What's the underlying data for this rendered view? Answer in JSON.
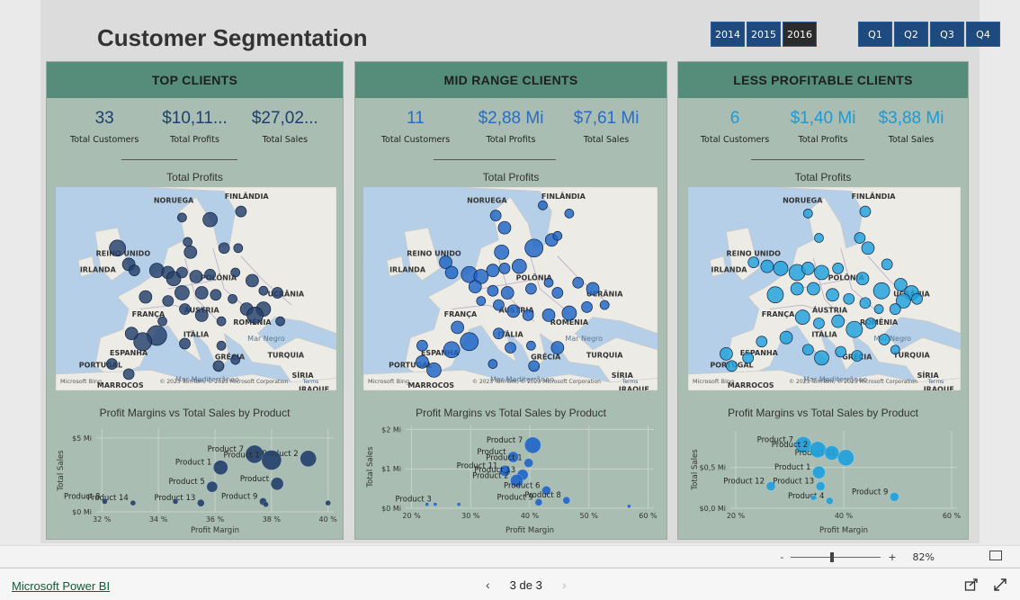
{
  "page_title": "Customer Segmentation",
  "years": [
    "2014",
    "2015",
    "2016"
  ],
  "selected_year": "2016",
  "quarters": [
    "Q1",
    "Q2",
    "Q3",
    "Q4"
  ],
  "panels": [
    {
      "id": "top",
      "header": "TOP CLIENTS",
      "kpis": [
        {
          "value": "33",
          "label": "Total Customers"
        },
        {
          "value": "$10,11...",
          "label": "Total Profits"
        },
        {
          "value": "$27,02...",
          "label": "Total Sales"
        }
      ],
      "kpi_color": "#1e3f70",
      "map_title": "Total Profits",
      "bubble_color": "#243f6b",
      "scatter_title": "Profit Margins vs Total Sales by Product"
    },
    {
      "id": "mid",
      "header": "MID RANGE CLIENTS",
      "kpis": [
        {
          "value": "11",
          "label": "Total Customers"
        },
        {
          "value": "$2,88 Mi",
          "label": "Total Profits"
        },
        {
          "value": "$7,61 Mi",
          "label": "Total Sales"
        }
      ],
      "kpi_color": "#2a6bc4",
      "map_title": "Total Profits",
      "bubble_color": "#1e64c6",
      "scatter_title": "Profit Margins vs Total Sales by Product"
    },
    {
      "id": "less",
      "header": "LESS PROFITABLE CLIENTS",
      "kpis": [
        {
          "value": "6",
          "label": "Total Customers"
        },
        {
          "value": "$1,40 Mi",
          "label": "Total Profits"
        },
        {
          "value": "$3,88 Mi",
          "label": "Total Sales"
        }
      ],
      "kpi_color": "#1d9ad6",
      "map_title": "Total Profits",
      "bubble_color": "#1ea0dc",
      "scatter_title": "Profit Margins vs Total Sales by Product"
    }
  ],
  "map_labels": [
    "NORUEGA",
    "FINLÂNDIA",
    "REINO UNIDO",
    "IRLANDA",
    "POLÔNIA",
    "UCRÂNIA",
    "FRANÇA",
    "ÁUSTRIA",
    "ROMÊNIA",
    "ITÁLIA",
    "Mar Negro",
    "ESPANHA",
    "GRÉCIA",
    "TURQUIA",
    "PORTUGAL",
    "Mar Mediterrâneo",
    "SÍRIA",
    "MARROCOS",
    "IRAQUE"
  ],
  "map_credit": "© 2023 TomTom, © 2023 Microsoft Corporation",
  "map_terms": "Terms",
  "map_brand": "Microsoft Bing",
  "chart_data": [
    {
      "type": "scatter",
      "title": "Profit Margins vs Total Sales by Product",
      "xlabel": "Profit Margin",
      "ylabel": "Total Sales",
      "x_ticks": [
        "32 %",
        "34 %",
        "36 %",
        "38 %",
        "40 %"
      ],
      "y_ticks": [
        "$0 Mi",
        "$5 Mi"
      ],
      "xlim": [
        31.8,
        40.2
      ],
      "ylim": [
        0,
        5.6
      ],
      "points": [
        {
          "label": "Product 7",
          "x": 37.4,
          "y": 3.9,
          "size": 10
        },
        {
          "label": "Product 2",
          "x": 39.3,
          "y": 3.6,
          "size": 9
        },
        {
          "label": "Product 1",
          "x": 36.2,
          "y": 3.0,
          "size": 8
        },
        {
          "label": "Product 1",
          "x": 38.0,
          "y": 3.5,
          "size": 11
        },
        {
          "label": "Product 5",
          "x": 35.9,
          "y": 1.7,
          "size": 6
        },
        {
          "label": "Product",
          "x": 38.2,
          "y": 1.9,
          "size": 7
        },
        {
          "label": "Product 8",
          "x": 32.1,
          "y": 0.7,
          "size": 3
        },
        {
          "label": "Product 14",
          "x": 33.1,
          "y": 0.6,
          "size": 3
        },
        {
          "label": "Product 13",
          "x": 35.5,
          "y": 0.6,
          "size": 4
        },
        {
          "label": "Product 9",
          "x": 37.7,
          "y": 0.7,
          "size": 4
        },
        {
          "label": "",
          "x": 34.6,
          "y": 0.7,
          "size": 3
        },
        {
          "label": "",
          "x": 40.0,
          "y": 0.6,
          "size": 3
        },
        {
          "label": "",
          "x": 37.8,
          "y": 0.5,
          "size": 3
        }
      ]
    },
    {
      "type": "scatter",
      "title": "Profit Margins vs Total Sales by Product",
      "xlabel": "Profit Margin",
      "ylabel": "Total Sales",
      "x_ticks": [
        "20 %",
        "30 %",
        "40 %",
        "50 %",
        "60 %"
      ],
      "y_ticks": [
        "$0 Mi",
        "$1 Mi",
        "$2 Mi"
      ],
      "xlim": [
        19,
        61
      ],
      "ylim": [
        0,
        2.1
      ],
      "points": [
        {
          "label": "Product 7",
          "x": 40.5,
          "y": 1.6,
          "size": 9
        },
        {
          "label": "Product",
          "x": 37.2,
          "y": 1.3,
          "size": 6
        },
        {
          "label": "Product 1",
          "x": 39.8,
          "y": 1.15,
          "size": 5
        },
        {
          "label": "Product 11",
          "x": 35.8,
          "y": 0.95,
          "size": 6
        },
        {
          "label": "Product 13",
          "x": 38.8,
          "y": 0.85,
          "size": 6
        },
        {
          "label": "Product 2",
          "x": 37.8,
          "y": 0.7,
          "size": 7
        },
        {
          "label": "Product 6",
          "x": 42.8,
          "y": 0.45,
          "size": 5
        },
        {
          "label": "Product 9",
          "x": 41.5,
          "y": 0.15,
          "size": 4
        },
        {
          "label": "Product 8",
          "x": 46.2,
          "y": 0.2,
          "size": 4
        },
        {
          "label": "Product 3",
          "x": 24.0,
          "y": 0.1,
          "size": 2
        },
        {
          "label": "",
          "x": 28.0,
          "y": 0.1,
          "size": 2
        },
        {
          "label": "",
          "x": 22.6,
          "y": 0.1,
          "size": 2
        },
        {
          "label": "",
          "x": 56.8,
          "y": 0.05,
          "size": 2
        }
      ]
    },
    {
      "type": "scatter",
      "title": "Profit Margins vs Total Sales by Product",
      "xlabel": "Profit Margin",
      "ylabel": "Total Sales",
      "x_ticks": [
        "20 %",
        "40 %",
        "60 %"
      ],
      "y_ticks": [
        "$0,0 Mi",
        "$0,5 Mi"
      ],
      "xlim": [
        19,
        61
      ],
      "ylim": [
        0,
        0.95
      ],
      "points": [
        {
          "label": "Product 7",
          "x": 32.5,
          "y": 0.78,
          "size": 9
        },
        {
          "label": "Product 11",
          "x": 40.4,
          "y": 0.62,
          "size": 9
        },
        {
          "label": "Product 2",
          "x": 35.2,
          "y": 0.72,
          "size": 9
        },
        {
          "label": "",
          "x": 37.8,
          "y": 0.68,
          "size": 8
        },
        {
          "label": "Product 1",
          "x": 35.4,
          "y": 0.44,
          "size": 7
        },
        {
          "label": "Product 12",
          "x": 26.5,
          "y": 0.27,
          "size": 5
        },
        {
          "label": "Product 13",
          "x": 35.7,
          "y": 0.27,
          "size": 5
        },
        {
          "label": "Product 9",
          "x": 49.4,
          "y": 0.14,
          "size": 5
        },
        {
          "label": "Product 4",
          "x": 37.4,
          "y": 0.09,
          "size": 4
        },
        {
          "label": "",
          "x": 34.4,
          "y": 0.13,
          "size": 3
        }
      ]
    }
  ],
  "zoom": {
    "value": "82%",
    "minus": "-",
    "plus": "+"
  },
  "footer": {
    "brand": "Microsoft Power BI",
    "page": "3 de 3",
    "prev": "‹",
    "next": "›"
  }
}
